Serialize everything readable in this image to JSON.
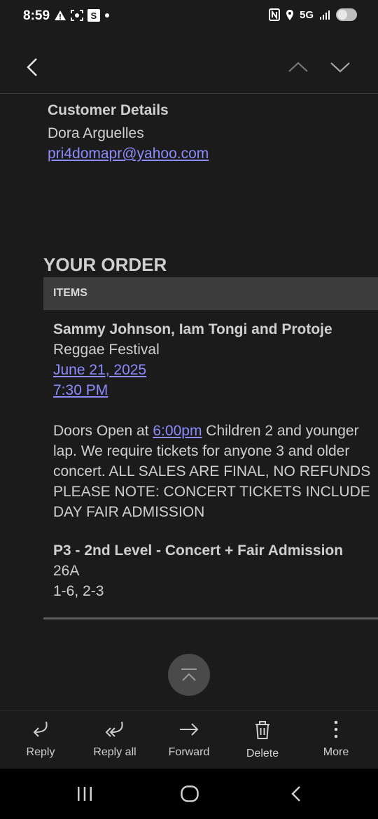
{
  "status_bar": {
    "time": "8:59",
    "network": "5G"
  },
  "customer": {
    "title": "Customer Details",
    "name": "Dora Arguelles",
    "email": "pri4domapr@yahoo.com"
  },
  "order": {
    "title": "YOUR ORDER",
    "items_header": "ITEMS",
    "event_name": "Sammy Johnson, Iam Tongi and Protoje",
    "event_subtitle": "Reggae Festival",
    "date": "June 21, 2025",
    "time": "7:30 PM",
    "notes_prefix": "Doors Open at ",
    "notes_time_link": "6:00pm",
    "notes_line1_rest": " Children 2 and younger",
    "notes_line2": "lap. We require tickets for anyone 3 and older",
    "notes_line3": "concert. ALL SALES ARE FINAL, NO REFUNDS",
    "notes_line4": "PLEASE NOTE: CONCERT TICKETS INCLUDE",
    "notes_line5": "DAY FAIR ADMISSION",
    "ticket_type": "P3 - 2nd Level - Concert + Fair Admission",
    "section": "26A",
    "seats": "1-6, 2-3"
  },
  "actions": [
    {
      "label": "Reply",
      "icon": "reply-icon"
    },
    {
      "label": "Reply all",
      "icon": "reply-all-icon"
    },
    {
      "label": "Forward",
      "icon": "forward-icon"
    },
    {
      "label": "Delete",
      "icon": "trash-icon"
    },
    {
      "label": "More",
      "icon": "more-vertical-icon"
    }
  ]
}
